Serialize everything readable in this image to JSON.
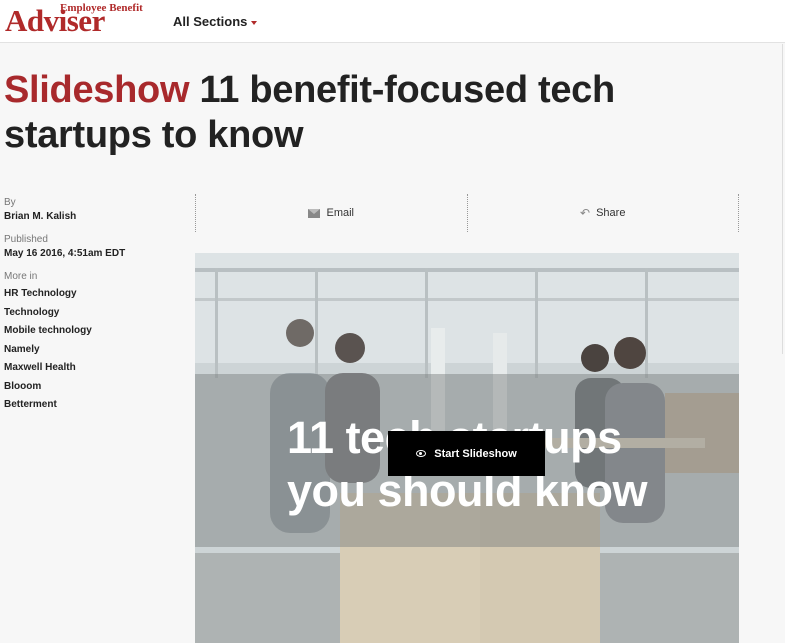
{
  "header": {
    "logo_top": "Employee Benefit",
    "logo_main": "Adviser",
    "sections_label": "All Sections",
    "colors": {
      "brand": "#a8292c"
    }
  },
  "article": {
    "kicker": "Slideshow",
    "title": "11 benefit-focused tech startups to know"
  },
  "meta": {
    "by_label": "By",
    "author": "Brian M. Kalish",
    "published_label": "Published",
    "published_date": "May 16 2016, 4:51am EDT",
    "more_label": "More in",
    "more_items": [
      "HR Technology",
      "Technology",
      "Mobile technology",
      "Namely",
      "Maxwell Health",
      "Blooom",
      "Betterment"
    ]
  },
  "share": {
    "email_label": "Email",
    "email_icon": "envelope-icon",
    "share_label": "Share",
    "share_icon": "reply-arrow-icon"
  },
  "hero": {
    "overlay_text_line1": "11 tech startups",
    "overlay_text_line2": "you should know",
    "button_label": "Start Slideshow",
    "button_icon": "eye-icon"
  }
}
